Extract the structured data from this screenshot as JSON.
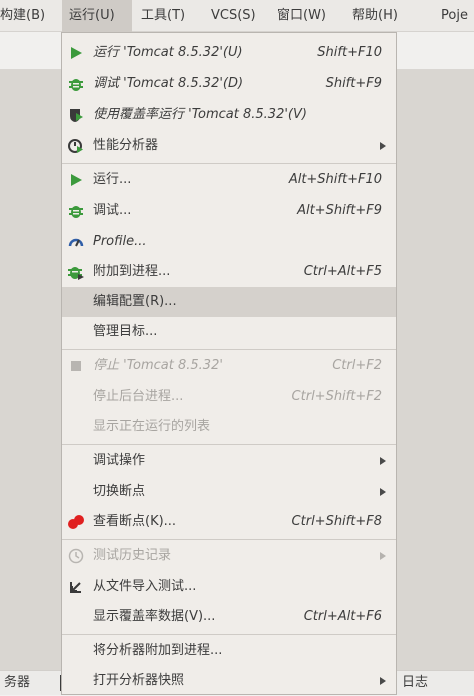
{
  "menubar": {
    "items": [
      "构建(B)",
      "运行(U)",
      "工具(T)",
      "VCS(S)",
      "窗口(W)",
      "帮助(H)",
      "Poje"
    ]
  },
  "bottom": {
    "left": "务器",
    "right": "日志"
  },
  "menu": {
    "items": [
      {
        "label": "运行 'Tomcat 8.5.32'(U)",
        "shortcut": "Shift+F10",
        "icon": "run-icon"
      },
      {
        "label": "调试 'Tomcat 8.5.32'(D)",
        "shortcut": "Shift+F9",
        "icon": "debug-icon"
      },
      {
        "label": "使用覆盖率运行 'Tomcat 8.5.32'(V)",
        "shortcut": "",
        "icon": "coverage-icon"
      },
      {
        "label": "性能分析器",
        "shortcut": "",
        "icon": "profiler-icon",
        "submenu": true
      },
      {
        "label": "运行...",
        "shortcut": "Alt+Shift+F10",
        "icon": "run-icon"
      },
      {
        "label": "调试...",
        "shortcut": "Alt+Shift+F9",
        "icon": "debug-icon"
      },
      {
        "label": "Profile...",
        "shortcut": "",
        "icon": "gauge-icon"
      },
      {
        "label": "附加到进程...",
        "shortcut": "Ctrl+Alt+F5",
        "icon": "attach-debug-icon"
      },
      {
        "label": "编辑配置(R)...",
        "shortcut": "",
        "icon": ""
      },
      {
        "label": "管理目标...",
        "shortcut": "",
        "icon": ""
      },
      {
        "label": "停止 'Tomcat 8.5.32'",
        "shortcut": "Ctrl+F2",
        "icon": "stop-icon"
      },
      {
        "label": "停止后台进程...",
        "shortcut": "Ctrl+Shift+F2",
        "icon": ""
      },
      {
        "label": "显示正在运行的列表",
        "shortcut": "",
        "icon": ""
      },
      {
        "label": "调试操作",
        "shortcut": "",
        "icon": "",
        "submenu": true
      },
      {
        "label": "切换断点",
        "shortcut": "",
        "icon": "",
        "submenu": true
      },
      {
        "label": "查看断点(K)...",
        "shortcut": "Ctrl+Shift+F8",
        "icon": "breakpoints-icon"
      },
      {
        "label": "测试历史记录",
        "shortcut": "",
        "icon": "history-icon",
        "submenu": true
      },
      {
        "label": "从文件导入测试...",
        "shortcut": "",
        "icon": "import-icon"
      },
      {
        "label": "显示覆盖率数据(V)...",
        "shortcut": "Ctrl+Alt+F6",
        "icon": ""
      },
      {
        "label": "将分析器附加到进程...",
        "shortcut": "",
        "icon": ""
      },
      {
        "label": "打开分析器快照",
        "shortcut": "",
        "icon": "",
        "submenu": true
      }
    ]
  }
}
